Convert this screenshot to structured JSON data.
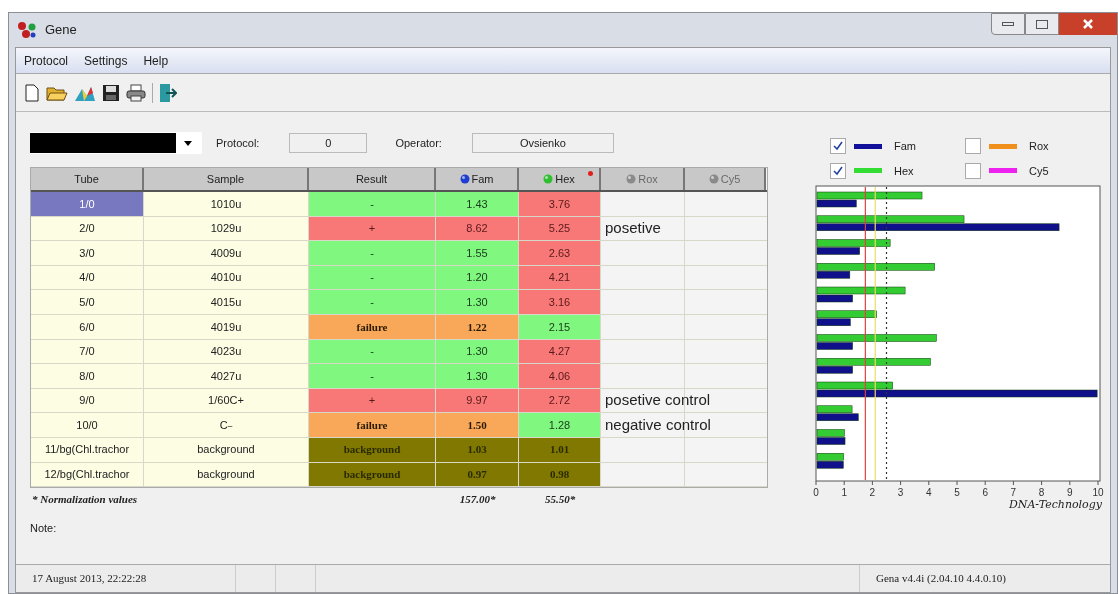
{
  "window": {
    "title": "Gene"
  },
  "menu": [
    "Protocol",
    "Settings",
    "Help"
  ],
  "header_fields": {
    "protocol_label": "Protocol:",
    "protocol_value": "0",
    "operator_label": "Operator:",
    "operator_value": "Ovsienko"
  },
  "table": {
    "columns": [
      {
        "label": "Tube",
        "kind": "plain",
        "disabled": false
      },
      {
        "label": "Sample",
        "kind": "plain",
        "disabled": false
      },
      {
        "label": "Result",
        "kind": "plain",
        "disabled": false
      },
      {
        "label": "Fam",
        "kind": "dye",
        "color": "#1f3fd0",
        "disabled": false
      },
      {
        "label": "Hex",
        "kind": "dye",
        "color": "#2fbf2f",
        "disabled": false
      },
      {
        "label": "Rox",
        "kind": "dye",
        "color": "#8a8a8a",
        "disabled": true
      },
      {
        "label": "Cy5",
        "kind": "dye",
        "color": "#8a8a8a",
        "disabled": true
      }
    ],
    "rows": [
      {
        "tube": "1/0",
        "selected": true,
        "sample": "1010u",
        "result": {
          "text": "-",
          "kind": "neg"
        },
        "fam": {
          "text": "1.43",
          "kind": "neg"
        },
        "hex": {
          "text": "3.76",
          "kind": "pos"
        }
      },
      {
        "tube": "2/0",
        "selected": false,
        "sample": "1029u",
        "result": {
          "text": "+",
          "kind": "pos"
        },
        "fam": {
          "text": "8.62",
          "kind": "pos"
        },
        "hex": {
          "text": "5.25",
          "kind": "pos"
        },
        "note": "posetive"
      },
      {
        "tube": "3/0",
        "selected": false,
        "sample": "4009u",
        "result": {
          "text": "-",
          "kind": "neg"
        },
        "fam": {
          "text": "1.55",
          "kind": "neg"
        },
        "hex": {
          "text": "2.63",
          "kind": "pos"
        }
      },
      {
        "tube": "4/0",
        "selected": false,
        "sample": "4010u",
        "result": {
          "text": "-",
          "kind": "neg"
        },
        "fam": {
          "text": "1.20",
          "kind": "neg"
        },
        "hex": {
          "text": "4.21",
          "kind": "pos"
        }
      },
      {
        "tube": "5/0",
        "selected": false,
        "sample": "4015u",
        "result": {
          "text": "-",
          "kind": "neg"
        },
        "fam": {
          "text": "1.30",
          "kind": "neg"
        },
        "hex": {
          "text": "3.16",
          "kind": "pos"
        }
      },
      {
        "tube": "6/0",
        "selected": false,
        "sample": "4019u",
        "result": {
          "text": "failure",
          "kind": "fail"
        },
        "fam": {
          "text": "1.22",
          "kind": "fail"
        },
        "hex": {
          "text": "2.15",
          "kind": "neg"
        }
      },
      {
        "tube": "7/0",
        "selected": false,
        "sample": "4023u",
        "result": {
          "text": "-",
          "kind": "neg"
        },
        "fam": {
          "text": "1.30",
          "kind": "neg"
        },
        "hex": {
          "text": "4.27",
          "kind": "pos"
        }
      },
      {
        "tube": "8/0",
        "selected": false,
        "sample": "4027u",
        "result": {
          "text": "-",
          "kind": "neg"
        },
        "fam": {
          "text": "1.30",
          "kind": "neg"
        },
        "hex": {
          "text": "4.06",
          "kind": "pos"
        }
      },
      {
        "tube": "9/0",
        "selected": false,
        "sample": "1/60C+",
        "result": {
          "text": "+",
          "kind": "pos"
        },
        "fam": {
          "text": "9.97",
          "kind": "pos"
        },
        "hex": {
          "text": "2.72",
          "kind": "pos"
        },
        "note": "posetive control"
      },
      {
        "tube": "10/0",
        "selected": false,
        "sample": "C$_{–}$",
        "result": {
          "text": "failure",
          "kind": "fail"
        },
        "fam": {
          "text": "1.50",
          "kind": "fail"
        },
        "hex": {
          "text": "1.28",
          "kind": "neg"
        },
        "note": "negative control"
      },
      {
        "tube": "11/bg(Chl.trachor",
        "selected": false,
        "sample": "background",
        "result": {
          "text": "background",
          "kind": "bg"
        },
        "fam": {
          "text": "1.03",
          "kind": "bg"
        },
        "hex": {
          "text": "1.01",
          "kind": "bg"
        }
      },
      {
        "tube": "12/bg(Chl.trachor",
        "selected": false,
        "sample": "background",
        "result": {
          "text": "background",
          "kind": "bg"
        },
        "fam": {
          "text": "0.97",
          "kind": "bg"
        },
        "hex": {
          "text": "0.98",
          "kind": "bg"
        }
      }
    ],
    "footnote": "* Normalization values",
    "fam_norm": "157.00*",
    "hex_norm": "55.50*"
  },
  "note_label": "Note:",
  "legend": [
    {
      "label": "Fam",
      "checked": true,
      "color": "#10109a"
    },
    {
      "label": "Rox",
      "checked": false,
      "color": "#f0901a"
    },
    {
      "label": "Hex",
      "checked": true,
      "color": "#33dd33"
    },
    {
      "label": "Cy5",
      "checked": false,
      "color": "#ee22ee"
    }
  ],
  "chart": {
    "chart_data": {
      "type": "bar",
      "orientation": "horizontal",
      "xlim": [
        0,
        10
      ],
      "xticks": [
        0,
        1,
        2,
        3,
        4,
        5,
        6,
        7,
        8,
        9,
        10
      ],
      "series": [
        {
          "color": "#33cc33",
          "values": [
            3.76,
            5.25,
            2.63,
            4.21,
            3.16,
            2.15,
            4.27,
            4.06,
            2.72,
            1.28,
            1.01,
            0.98
          ]
        },
        {
          "color": "#10108a",
          "values": [
            1.43,
            8.62,
            1.55,
            1.2,
            1.3,
            1.22,
            1.3,
            1.3,
            9.97,
            1.5,
            1.03,
            0.97
          ]
        }
      ],
      "ref_lines": [
        {
          "axis": "x",
          "value": 1.75
        },
        {
          "axis": "x",
          "value": 2.1
        },
        {
          "axis": "x",
          "value": 2.5
        }
      ]
    }
  },
  "logo": "DNA-Technology",
  "status_bar": {
    "datetime": "17 August 2013,  22:22:28",
    "version": "Gena v4.4i  (2.04.10  4.4.0.10)"
  }
}
